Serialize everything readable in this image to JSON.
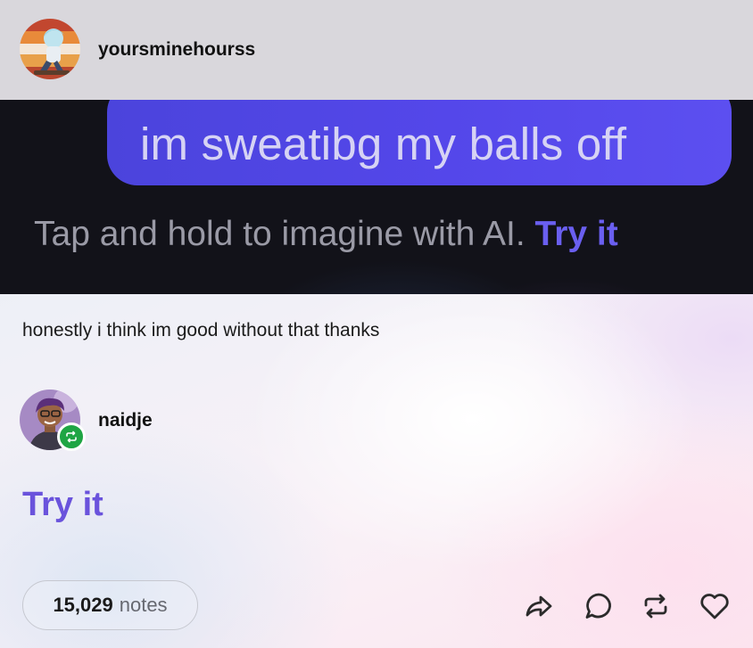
{
  "post": {
    "author": "yoursminehourss",
    "image": {
      "bubble_text": "im sweatibg my balls off",
      "hint_text": "Tap and hold to imagine with AI.",
      "hint_link": "Try it"
    },
    "body": "honestly i think im good without that thanks"
  },
  "reblog": {
    "author": "naidje",
    "body": "Try it"
  },
  "footer": {
    "notes_count": "15,029",
    "notes_label": "notes",
    "actions": [
      "share-icon",
      "reply-icon",
      "reblog-icon",
      "like-icon"
    ]
  },
  "colors": {
    "header_bg": "#d9d7dc",
    "bubble": "#5447ea",
    "link": "#6a53dc",
    "reblog_badge": "#1fa544"
  }
}
